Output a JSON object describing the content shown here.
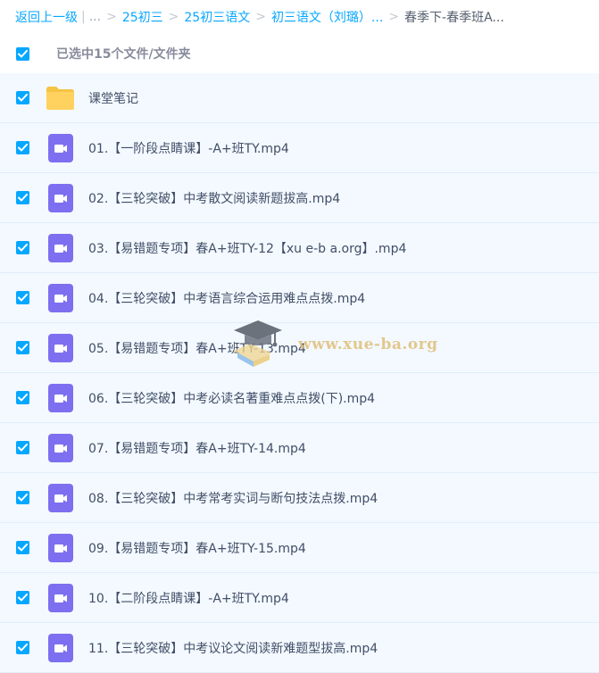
{
  "breadcrumb": {
    "back": "返回上一级",
    "ellipsis": "...",
    "crumbs": [
      "25初三",
      "25初三语文",
      "初三语文（刘璐）..."
    ],
    "current": "春季下-春季班A..."
  },
  "selection": {
    "label": "已选中15个文件/文件夹"
  },
  "files": [
    {
      "name": "课堂笔记",
      "icon": "folder-icon"
    },
    {
      "name": "01.【一阶段点睛课】-A+班TY.mp4",
      "icon": "video-icon"
    },
    {
      "name": "02.【三轮突破】中考散文阅读新题拔高.mp4",
      "icon": "video-icon"
    },
    {
      "name": "03.【易错题专项】春A+班TY-12【xu e-b a.org】.mp4",
      "icon": "video-icon"
    },
    {
      "name": "04.【三轮突破】中考语言综合运用难点点拨.mp4",
      "icon": "video-icon"
    },
    {
      "name": "05.【易错题专项】春A+班TY-13.mp4",
      "icon": "video-icon"
    },
    {
      "name": "06.【三轮突破】中考必读名著重难点点拨(下).mp4",
      "icon": "video-icon"
    },
    {
      "name": "07.【易错题专项】春A+班TY-14.mp4",
      "icon": "video-icon"
    },
    {
      "name": "08.【三轮突破】中考常考实词与断句技法点拨.mp4",
      "icon": "video-icon"
    },
    {
      "name": "09.【易错题专项】春A+班TY-15.mp4",
      "icon": "video-icon"
    },
    {
      "name": "10.【二阶段点睛课】-A+班TY.mp4",
      "icon": "video-icon"
    },
    {
      "name": "11.【三轮突破】中考议论文阅读新难题型拔高.mp4",
      "icon": "video-icon"
    }
  ],
  "watermark": {
    "text": "www.xue-ba.org"
  },
  "colors": {
    "accent": "#06a7ff",
    "video": "#7d6ff0",
    "folder": "#ffd15e",
    "row_bg": "#f3f9ff"
  }
}
